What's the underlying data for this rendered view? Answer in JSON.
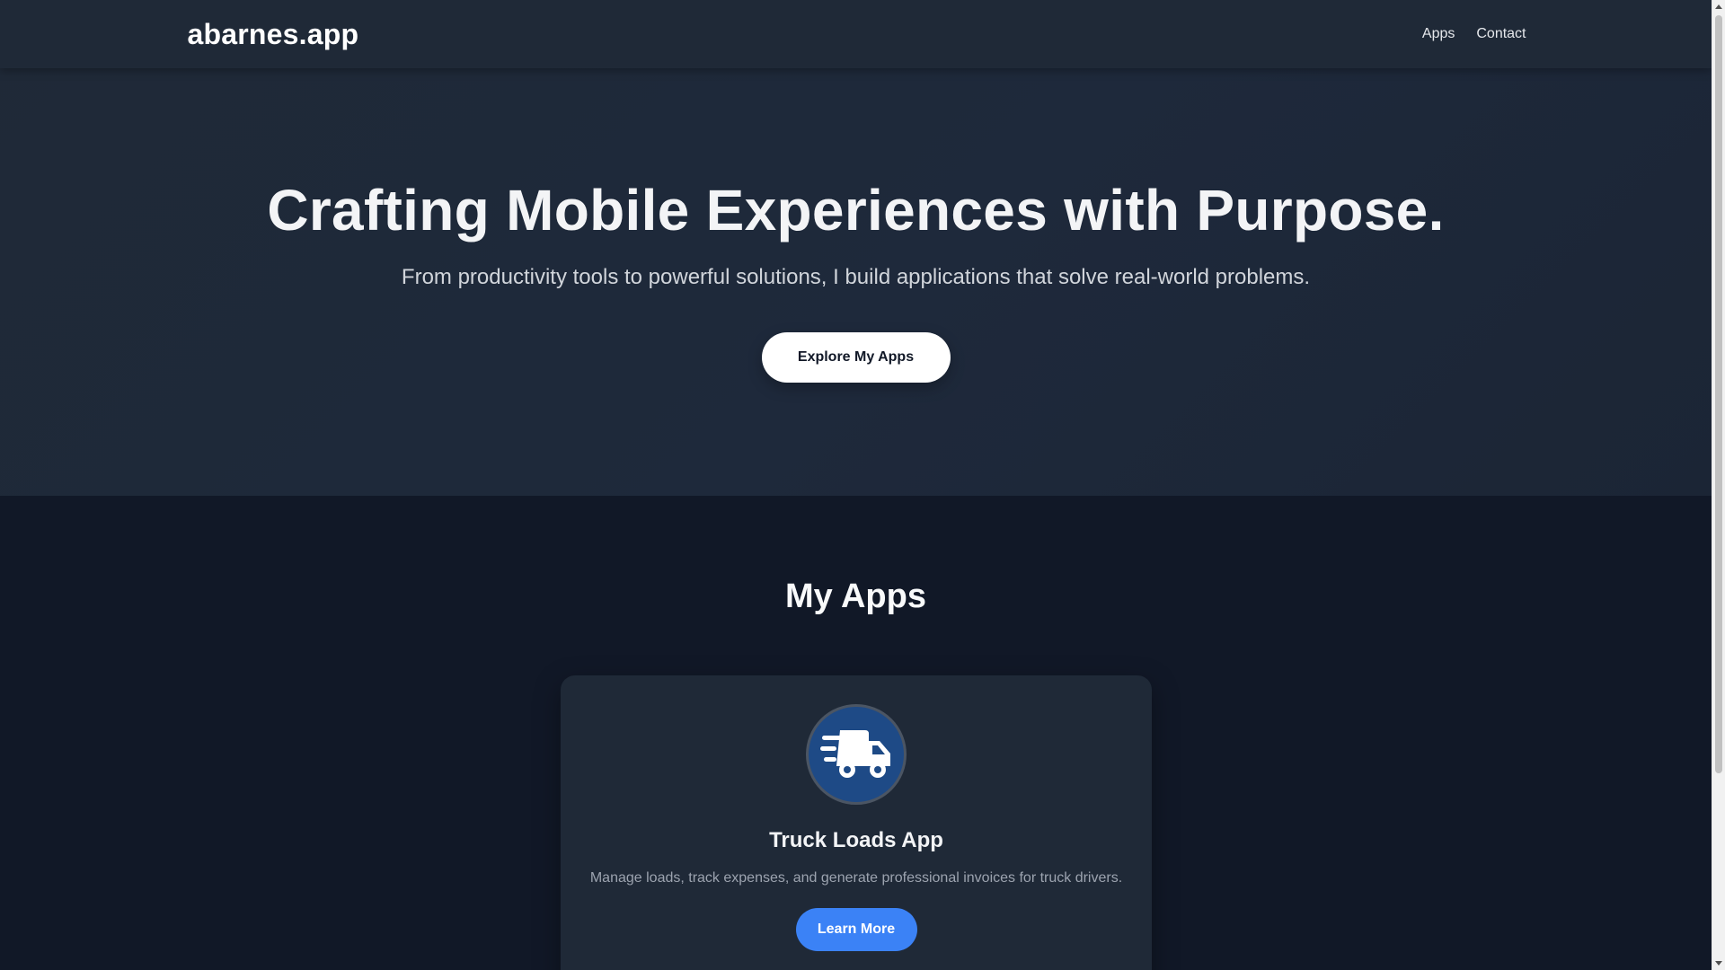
{
  "nav": {
    "logo": "abarnes.app",
    "links": [
      {
        "label": "Apps"
      },
      {
        "label": "Contact"
      }
    ]
  },
  "hero": {
    "title": "Crafting Mobile Experiences with Purpose.",
    "subtitle": "From productivity tools to powerful solutions, I build applications that solve real-world problems.",
    "cta_label": "Explore My Apps"
  },
  "apps": {
    "section_title": "My Apps",
    "items": [
      {
        "icon": "truck-icon",
        "name": "Truck Loads App",
        "description": "Manage loads, track expenses, and generate professional invoices for truck drivers.",
        "button_label": "Learn More"
      }
    ]
  },
  "colors": {
    "nav_bg": "#1f2937",
    "hero_bg": "#1e293b",
    "section_bg": "#111827",
    "card_bg": "#1f2937",
    "accent": "#3b82f6",
    "icon_bg": "#1e4a86"
  }
}
